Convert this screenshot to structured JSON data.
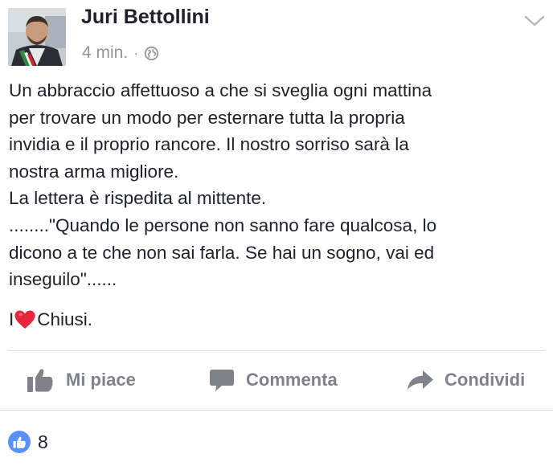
{
  "post": {
    "author_name": "Juri Bettollini",
    "timestamp": "4 min.",
    "separator": "·",
    "privacy_icon": "globe-icon",
    "avatar_icon": "profile-photo",
    "menu_icon": "chevron-down-icon",
    "body_lines": [
      "Un abbraccio affettuoso a che si sveglia ogni mattina",
      "per trovare un modo per esternare tutta la propria",
      "invidia e il proprio rancore. Il nostro sorriso sarà la",
      "nostra arma migliore.",
      "La lettera è rispedita al mittente.",
      "........\"Quando le persone non sanno fare qualcosa, lo",
      "dicono a te che non sai farla. Se hai un sogno, vai ed",
      "inseguilo\"......"
    ],
    "love_line": {
      "prefix": "I",
      "emoji_icon": "heart-icon",
      "suffix": "Chiusi."
    }
  },
  "actions": {
    "like_label": "Mi piace",
    "comment_label": "Commenta",
    "share_label": "Condividi"
  },
  "reactions": {
    "icon": "like-badge-icon",
    "count": "8"
  },
  "colors": {
    "text": "#1d2129",
    "meta": "#90949c",
    "action": "#7f8288",
    "like_blue": "#5890ff",
    "heart_red": "#e8253b",
    "divider": "#dadde1"
  }
}
